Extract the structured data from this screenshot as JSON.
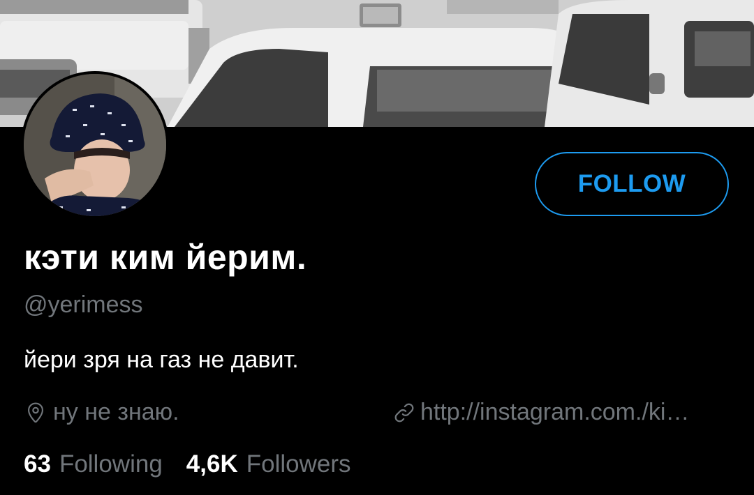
{
  "profile": {
    "display_name": "кэти ким йерим.",
    "handle": "@yerimess",
    "bio": "йери зря на газ не давит.",
    "location": "ну не знаю.",
    "website": "http://instagram.com./ki…",
    "follow_label": "FOLLOW"
  },
  "stats": {
    "following_count": "63",
    "following_label": "Following",
    "followers_count": "4,6K",
    "followers_label": "Followers"
  },
  "icons": {
    "location": "location-pin-icon",
    "website": "link-icon"
  },
  "colors": {
    "background": "#000000",
    "accent": "#1d9bf0",
    "secondary_text": "#71767b",
    "primary_text": "#ffffff"
  }
}
